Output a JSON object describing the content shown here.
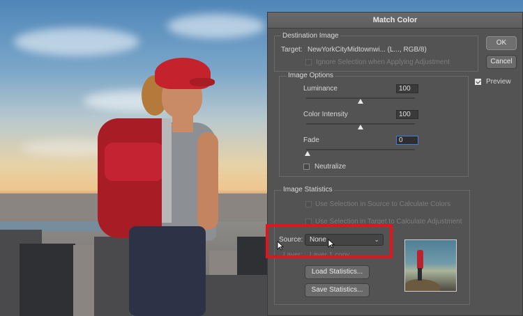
{
  "dialog": {
    "title": "Match Color",
    "ok_label": "OK",
    "cancel_label": "Cancel",
    "preview_label": "Preview",
    "preview_checked": true
  },
  "destination": {
    "title": "Destination Image",
    "target_prefix": "Target:",
    "target_value": "NewYorkCityMidtownwi... (L..., RGB/8)",
    "ignore_selection_label": "Ignore Selection when Applying Adjustment"
  },
  "image_options": {
    "title": "Image Options",
    "luminance_label": "Luminance",
    "luminance_value": "100",
    "luminance_level": 0.5,
    "intensity_label": "Color Intensity",
    "intensity_value": "100",
    "intensity_level": 0.5,
    "fade_label": "Fade",
    "fade_value": "0",
    "fade_level": 0.0,
    "neutralize_label": "Neutralize"
  },
  "statistics": {
    "title": "Image Statistics",
    "use_source_label": "Use Selection in Source to Calculate Colors",
    "use_target_label": "Use Selection in Target to Calculate Adjustment",
    "source_label": "Source:",
    "source_value": "None",
    "layer_label": "Layer:",
    "layer_value": "Layer 1 copy",
    "load_label": "Load Statistics...",
    "save_label": "Save Statistics..."
  },
  "colors": {
    "highlight": "#e3141b",
    "focus": "#3d7ee0"
  }
}
